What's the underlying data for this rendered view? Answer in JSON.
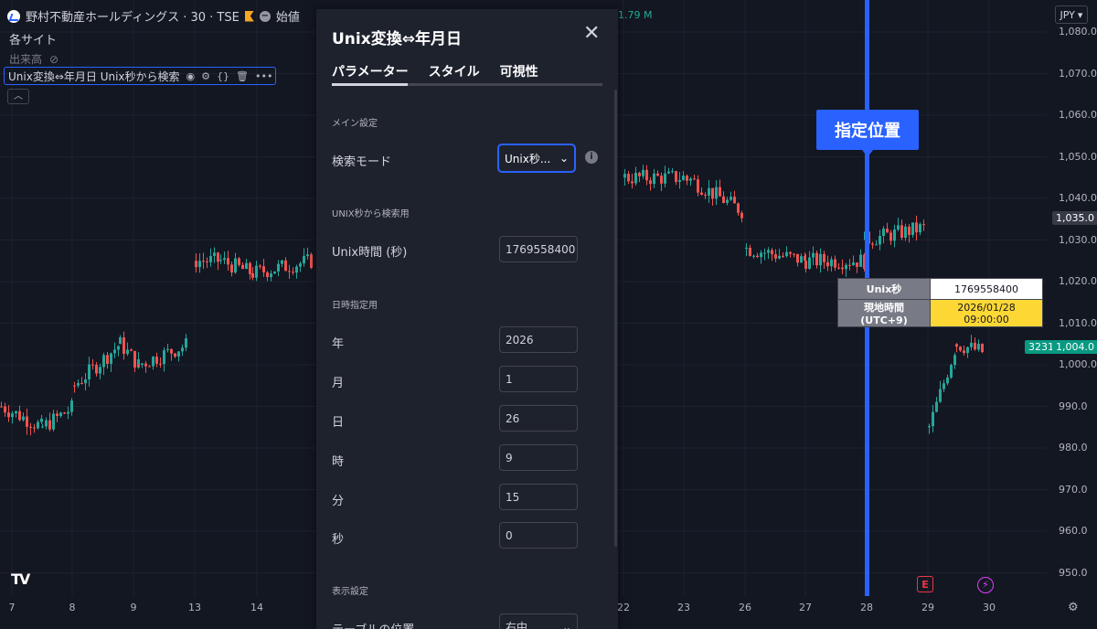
{
  "header": {
    "symbol": "野村不動産ホールディングス · 30 · TSE",
    "open_label": "始値",
    "volume_text": "1.79 M",
    "sites": "各サイト",
    "volume_label": "出来高",
    "indicator_name": "Unix変換⇔年月日 Unix秒から検索",
    "currency": "JPY"
  },
  "price_axis": [
    "1,080.0",
    "1,070.0",
    "1,060.0",
    "1,050.0",
    "1,040.0",
    "1,030.0",
    "1,020.0",
    "1,010.0",
    "1,000.0",
    "990.0",
    "980.0",
    "970.0",
    "960.0",
    "950.0"
  ],
  "price_badges": {
    "upper": "1,035.0",
    "lower_left": "3231",
    "lower": "1,004.0"
  },
  "date_axis": [
    "7",
    "8",
    "9",
    "13",
    "14",
    "22",
    "23",
    "26",
    "27",
    "28",
    "29",
    "30"
  ],
  "marker": {
    "label": "指定位置"
  },
  "info_table": [
    {
      "key": "Unix秒",
      "value": "1769558400"
    },
    {
      "key": "現地時間(UTC+9)",
      "value": "2026/01/28 09:00:00"
    }
  ],
  "events": {
    "earnings": "E",
    "flash": "⚡"
  },
  "dialog": {
    "title": "Unix変換⇔年月日",
    "tabs": [
      "パラメーター",
      "スタイル",
      "可視性"
    ],
    "sections": {
      "main": "メイン設定",
      "unix": "UNIX秒から検索用",
      "datetime": "日時指定用",
      "display": "表示設定"
    },
    "search_mode_label": "検索モード",
    "search_mode_value": "Unix秒...",
    "unix_time_label": "Unix時間 (秒)",
    "unix_time_value": "1769558400",
    "fields": [
      {
        "label": "年",
        "value": "2026"
      },
      {
        "label": "月",
        "value": "1"
      },
      {
        "label": "日",
        "value": "26"
      },
      {
        "label": "時",
        "value": "9"
      },
      {
        "label": "分",
        "value": "15"
      },
      {
        "label": "秒",
        "value": "0"
      }
    ],
    "table_position_label": "テーブルの位置",
    "table_position_value": "右中"
  },
  "colors": {
    "background": "#131722",
    "up": "#26a69a",
    "down": "#ef5350",
    "accent": "#2962ff",
    "highlight": "#fdd835"
  },
  "icons": [
    "eye-icon",
    "settings-icon",
    "braces-icon",
    "trash-icon",
    "more-icon",
    "close-icon",
    "chevron-down-icon",
    "info-icon",
    "tradingview-logo-icon",
    "gear-icon"
  ]
}
